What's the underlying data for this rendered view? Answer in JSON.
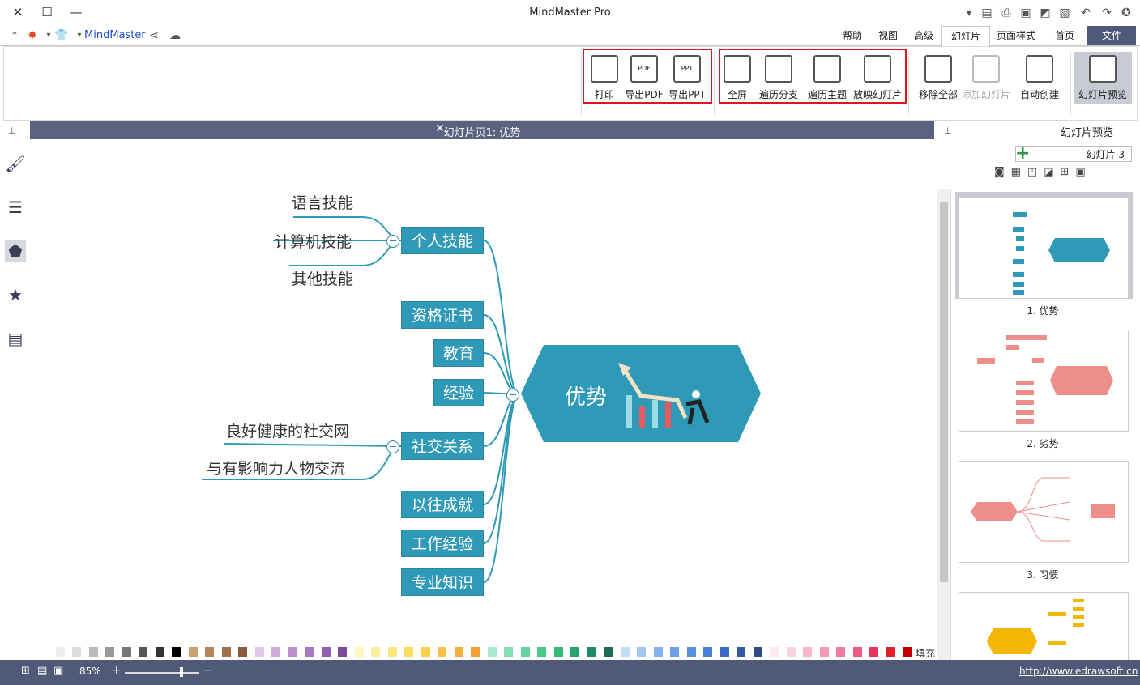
{
  "app": {
    "title": "MindMaster Pro",
    "brand": "MindMaster"
  },
  "tabs": [
    {
      "label": "文件"
    },
    {
      "label": "首页"
    },
    {
      "label": "页面样式"
    },
    {
      "label": "幻灯片"
    },
    {
      "label": "高级"
    },
    {
      "label": "视图"
    },
    {
      "label": "帮助"
    }
  ],
  "ribbon": {
    "slide_preview": "幻灯片预览",
    "auto_create": "自动创建",
    "add_slide": "添加幻灯片",
    "remove_all": "移除全部",
    "play_slides": "放映幻灯片",
    "traverse_topic": "遍历主题",
    "traverse_branch": "遍历分支",
    "fullscreen": "全屏",
    "export_ppt": "导出PPT",
    "export_pdf": "导出PDF",
    "print": "打印",
    "ppt_badge": "PPT",
    "pdf_badge": "PDF"
  },
  "canvas": {
    "header": "幻灯片页1: 优势",
    "central_topic": "优势",
    "topics": [
      {
        "label": "个人技能",
        "subs": [
          "语言技能",
          "计算机技能",
          "其他技能"
        ]
      },
      {
        "label": "资格证书",
        "subs": []
      },
      {
        "label": "教育",
        "subs": []
      },
      {
        "label": "经验",
        "subs": []
      },
      {
        "label": "社交关系",
        "subs": [
          "良好健康的社交网",
          "与有影响力人物交流"
        ]
      },
      {
        "label": "以往成就",
        "subs": []
      },
      {
        "label": "工作经验",
        "subs": []
      },
      {
        "label": "专业知识",
        "subs": []
      }
    ]
  },
  "right_panel": {
    "title": "幻灯片预览",
    "selector": "幻灯片 3",
    "slides": [
      {
        "label": "1. 优势"
      },
      {
        "label": "2. 劣势"
      },
      {
        "label": "3. 习惯"
      }
    ]
  },
  "colorbar": {
    "fill_label": "填充"
  },
  "status": {
    "zoom": "85%",
    "url": "http://www.edrawsoft.cn"
  },
  "colors": {
    "topic": "#2f9ab7",
    "header": "#5a6280",
    "statusbar": "#505a78",
    "highlight": "#e0141e"
  }
}
